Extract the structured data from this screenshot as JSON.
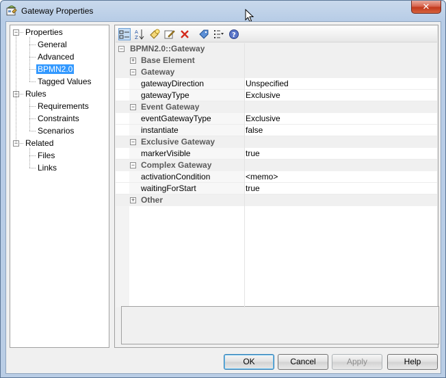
{
  "window": {
    "title": "Gateway Properties",
    "close_label": "✕"
  },
  "tree": {
    "items": [
      {
        "label": "Properties",
        "level": 0,
        "expander": "−"
      },
      {
        "label": "General",
        "level": 1
      },
      {
        "label": "Advanced",
        "level": 1
      },
      {
        "label": "BPMN2.0",
        "level": 1,
        "selected": true
      },
      {
        "label": "Tagged Values",
        "level": 1
      },
      {
        "label": "Rules",
        "level": 0,
        "expander": "−"
      },
      {
        "label": "Requirements",
        "level": 1
      },
      {
        "label": "Constraints",
        "level": 1
      },
      {
        "label": "Scenarios",
        "level": 1
      },
      {
        "label": "Related",
        "level": 0,
        "expander": "−"
      },
      {
        "label": "Files",
        "level": 1
      },
      {
        "label": "Links",
        "level": 1
      }
    ]
  },
  "toolbar": {
    "icons": [
      "categorized-view-icon",
      "sort-alpha-icon",
      "new-tag-icon",
      "edit-icon",
      "delete-icon",
      "tag-icon",
      "filter-list-icon",
      "help-icon"
    ]
  },
  "grid": {
    "root": {
      "label": "BPMN2.0::Gateway",
      "expander": "−"
    },
    "sections": [
      {
        "label": "Base Element",
        "expander": "+",
        "props": []
      },
      {
        "label": "Gateway",
        "expander": "−",
        "props": [
          {
            "name": "gatewayDirection",
            "value": "Unspecified"
          },
          {
            "name": "gatewayType",
            "value": "Exclusive"
          }
        ]
      },
      {
        "label": "Event Gateway",
        "expander": "−",
        "props": [
          {
            "name": "eventGatewayType",
            "value": "Exclusive"
          },
          {
            "name": "instantiate",
            "value": "false"
          }
        ]
      },
      {
        "label": "Exclusive Gateway",
        "expander": "−",
        "props": [
          {
            "name": "markerVisible",
            "value": "true"
          }
        ]
      },
      {
        "label": "Complex Gateway",
        "expander": "−",
        "props": [
          {
            "name": "activationCondition",
            "value": "<memo>"
          },
          {
            "name": "waitingForStart",
            "value": "true"
          }
        ]
      },
      {
        "label": "Other",
        "expander": "+",
        "props": []
      }
    ]
  },
  "buttons": {
    "ok": "OK",
    "cancel": "Cancel",
    "apply": "Apply",
    "help": "Help"
  }
}
